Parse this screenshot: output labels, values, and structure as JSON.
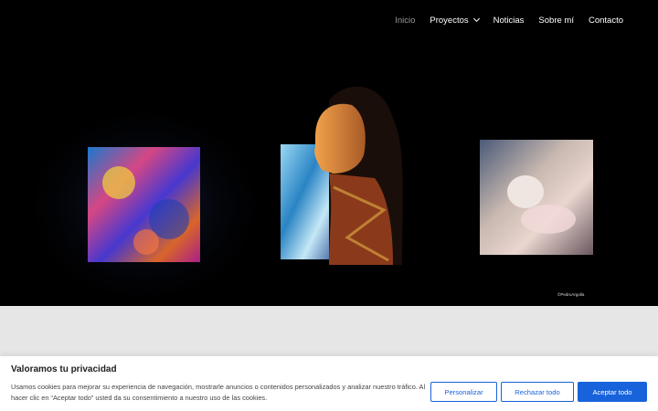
{
  "nav": {
    "items": [
      "Inicio",
      "Proyectos",
      "Noticias",
      "Sobre mí",
      "Contacto"
    ]
  },
  "hero": {
    "credit": "©PedroArgolla"
  },
  "cookie": {
    "title": "Valoramos tu privacidad",
    "text": "Usamos cookies para mejorar su experiencia de navegación, mostrarle anuncios o contenidos personalizados y analizar nuestro tráfico. Al hacer clic en “Aceptar todo” usted da su consentimiento a nuestro uso de las cookies.",
    "btn_customize": "Personalizar",
    "btn_reject": "Rechazar todo",
    "btn_accept": "Aceptar todo"
  },
  "colors": {
    "accent": "#1863dc",
    "hero_bg": "#000000",
    "band_bg": "#e6e6e6"
  }
}
